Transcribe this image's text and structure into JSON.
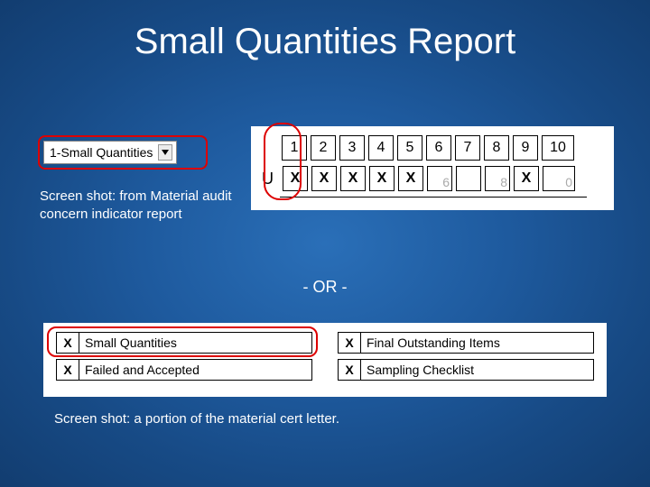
{
  "title": "Small Quantities Report",
  "dropdown": {
    "value": "1-Small Quantities"
  },
  "caption1": "Screen shot: from Material audit concern indicator report",
  "grid": {
    "u_label": "U",
    "headers": [
      "1",
      "2",
      "3",
      "4",
      "5",
      "6",
      "7",
      "8",
      "9",
      "10"
    ],
    "marks": [
      "X",
      "X",
      "X",
      "X",
      "X",
      "",
      "",
      "",
      "X",
      ""
    ],
    "ghosts": [
      "",
      "",
      "",
      "",
      "",
      "6",
      "",
      "8",
      "",
      "0"
    ]
  },
  "or_text": "- OR -",
  "options": {
    "left": [
      {
        "mark": "X",
        "label": "Small Quantities"
      },
      {
        "mark": "X",
        "label": "Failed and Accepted"
      }
    ],
    "right": [
      {
        "mark": "X",
        "label": "Final Outstanding Items"
      },
      {
        "mark": "X",
        "label": "Sampling Checklist"
      }
    ]
  },
  "caption2": "Screen shot: a portion of the material cert letter."
}
